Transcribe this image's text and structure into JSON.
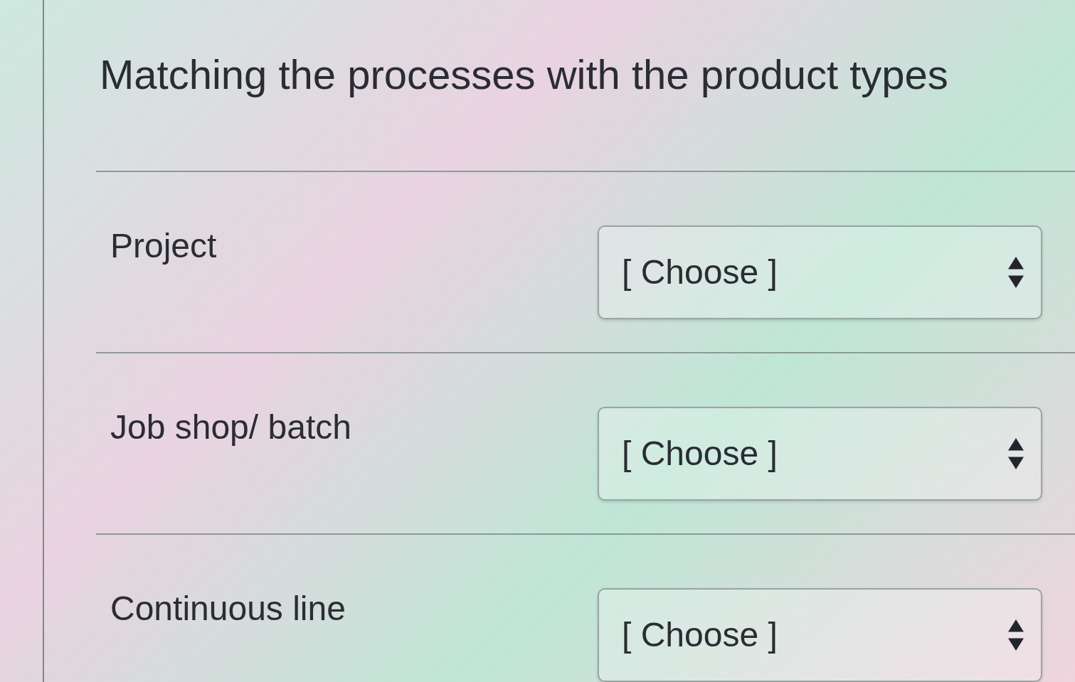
{
  "title": "Matching the processes with the product types",
  "rows": [
    {
      "label": "Project",
      "select": {
        "value": "[ Choose ]"
      }
    },
    {
      "label": "Job shop/ batch",
      "select": {
        "value": "[ Choose ]"
      }
    },
    {
      "label": "Continuous line",
      "select": {
        "value": "[ Choose ]"
      }
    }
  ]
}
